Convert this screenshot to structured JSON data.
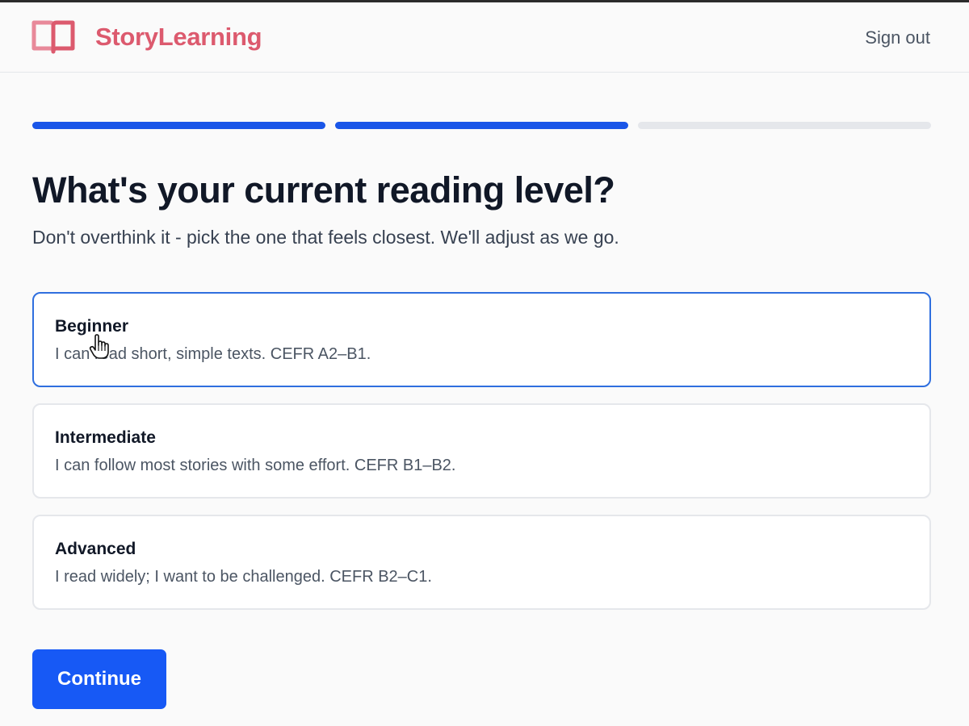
{
  "header": {
    "brand_name": "StoryLearning",
    "logo_icon": "open-book-icon",
    "sign_out_label": "Sign out"
  },
  "progress": {
    "total_steps": 3,
    "completed_steps": 2
  },
  "main": {
    "title": "What's your current reading level?",
    "subtitle": "Don't overthink it - pick the one that feels closest. We'll adjust as we go.",
    "selected_option": "Beginner",
    "options": [
      {
        "title": "Beginner",
        "description": "I can read short, simple texts. CEFR A2–B1."
      },
      {
        "title": "Intermediate",
        "description": "I can follow most stories with some effort. CEFR B1–B2."
      },
      {
        "title": "Advanced",
        "description": "I read widely; I want to be challenged. CEFR B2–C1."
      }
    ],
    "continue_label": "Continue"
  },
  "colors": {
    "brand": "#dc5a6e",
    "accent": "#1759f5",
    "progress_done": "#1a56e8",
    "progress_pending": "#e5e7eb",
    "selected_border": "#2f6fdf"
  }
}
